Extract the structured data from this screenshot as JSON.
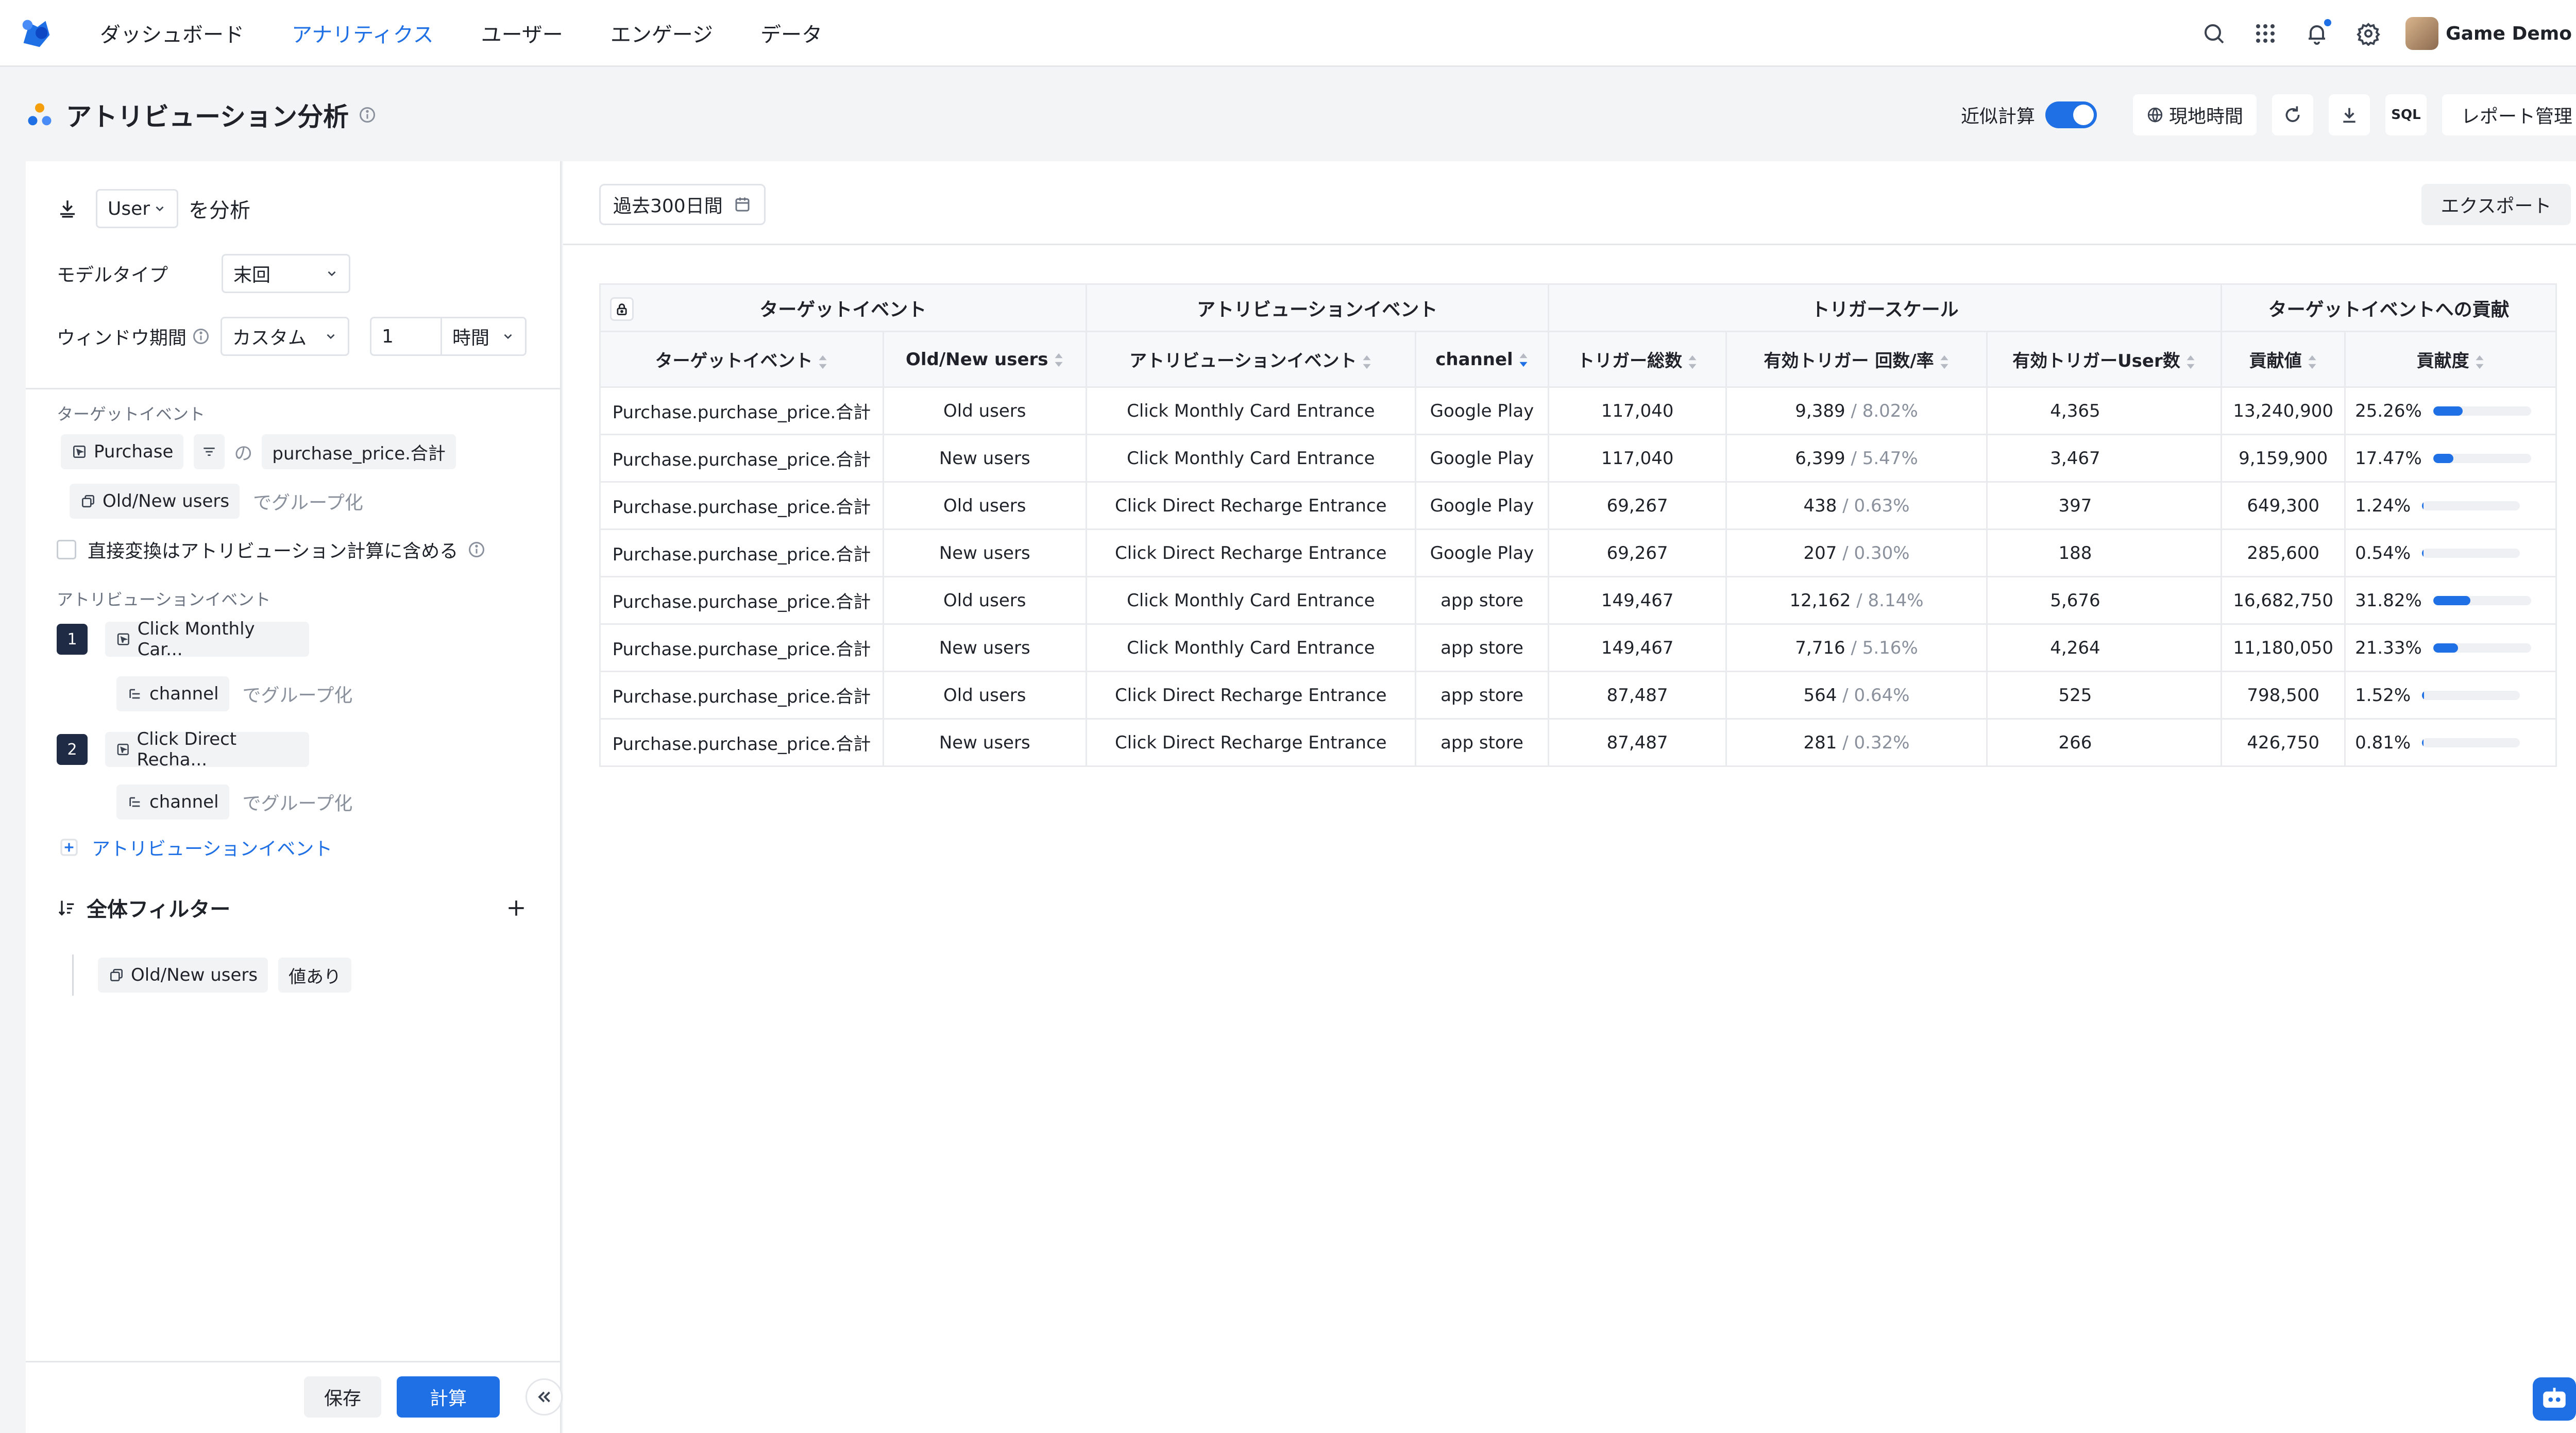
{
  "nav": {
    "items": [
      "ダッシュボード",
      "アナリティクス",
      "ユーザー",
      "エンゲージ",
      "データ"
    ],
    "active_index": 1,
    "user_name": "Game Demo",
    "accent": "#1f6fe5"
  },
  "header": {
    "title": "アトリビューション分析",
    "approx_label": "近似計算",
    "approx_on": true,
    "timezone_label": "現地時間",
    "sql_label": "SQL",
    "report_manage_label": "レポート管理"
  },
  "left": {
    "analyze_subject": "User",
    "analyze_suffix": "を分析",
    "model_type_label": "モデルタイプ",
    "model_type_value": "末回",
    "window_label": "ウィンドウ期間",
    "window_mode": "カスタム",
    "window_value": "1",
    "window_unit": "時間",
    "target_event_section": "ターゲットイベント",
    "target_event": "Purchase",
    "target_of": "の",
    "target_metric": "purchase_price.合計",
    "group_by_prop": "Old/New users",
    "group_by_suffix": "でグループ化",
    "include_direct_label": "直接変換はアトリビューション計算に含める",
    "attribution_section": "アトリビューションイベント",
    "attribution_events": [
      {
        "index": "1",
        "name": "Click Monthly Car...",
        "group_prop": "channel",
        "group_suffix": "でグループ化"
      },
      {
        "index": "2",
        "name": "Click Direct Recha...",
        "group_prop": "channel",
        "group_suffix": "でグループ化"
      }
    ],
    "add_attribution_label": "アトリビューションイベント",
    "global_filter_label": "全体フィルター",
    "filter_prop": "Old/New users",
    "filter_op": "値あり",
    "save_label": "保存",
    "calc_label": "計算"
  },
  "main": {
    "date_range": "過去300日間",
    "export_label": "エクスポート",
    "groups": [
      "ターゲットイベント",
      "アトリビューションイベント",
      "トリガースケール",
      "ターゲットイベントへの貢献"
    ],
    "columns": [
      "ターゲットイベント",
      "Old/New users",
      "アトリビューションイベント",
      "channel",
      "トリガー総数",
      "有効トリガー 回数/率",
      "有効トリガーUser数",
      "貢献値",
      "貢献度"
    ],
    "rows": [
      {
        "target": "Purchase.purchase_price.合計",
        "user_type": "Old users",
        "attr_event": "Click Monthly Card Entrance",
        "channel": "Google Play",
        "total": "117,040",
        "valid_count": "9,389",
        "valid_rate": "8.02%",
        "valid_users": "4,365",
        "contrib_value": "13,240,900",
        "contrib_pct": "25.26%",
        "contrib_frac": 0.2526
      },
      {
        "target": "Purchase.purchase_price.合計",
        "user_type": "New users",
        "attr_event": "Click Monthly Card Entrance",
        "channel": "Google Play",
        "total": "117,040",
        "valid_count": "6,399",
        "valid_rate": "5.47%",
        "valid_users": "3,467",
        "contrib_value": "9,159,900",
        "contrib_pct": "17.47%",
        "contrib_frac": 0.1747
      },
      {
        "target": "Purchase.purchase_price.合計",
        "user_type": "Old users",
        "attr_event": "Click Direct Recharge Entrance",
        "channel": "Google Play",
        "total": "69,267",
        "valid_count": "438",
        "valid_rate": "0.63%",
        "valid_users": "397",
        "contrib_value": "649,300",
        "contrib_pct": "1.24%",
        "contrib_frac": 0.0124
      },
      {
        "target": "Purchase.purchase_price.合計",
        "user_type": "New users",
        "attr_event": "Click Direct Recharge Entrance",
        "channel": "Google Play",
        "total": "69,267",
        "valid_count": "207",
        "valid_rate": "0.30%",
        "valid_users": "188",
        "contrib_value": "285,600",
        "contrib_pct": "0.54%",
        "contrib_frac": 0.0054
      },
      {
        "target": "Purchase.purchase_price.合計",
        "user_type": "Old users",
        "attr_event": "Click Monthly Card Entrance",
        "channel": "app store",
        "total": "149,467",
        "valid_count": "12,162",
        "valid_rate": "8.14%",
        "valid_users": "5,676",
        "contrib_value": "16,682,750",
        "contrib_pct": "31.82%",
        "contrib_frac": 0.3182
      },
      {
        "target": "Purchase.purchase_price.合計",
        "user_type": "New users",
        "attr_event": "Click Monthly Card Entrance",
        "channel": "app store",
        "total": "149,467",
        "valid_count": "7,716",
        "valid_rate": "5.16%",
        "valid_users": "4,264",
        "contrib_value": "11,180,050",
        "contrib_pct": "21.33%",
        "contrib_frac": 0.2133
      },
      {
        "target": "Purchase.purchase_price.合計",
        "user_type": "Old users",
        "attr_event": "Click Direct Recharge Entrance",
        "channel": "app store",
        "total": "87,487",
        "valid_count": "564",
        "valid_rate": "0.64%",
        "valid_users": "525",
        "contrib_value": "798,500",
        "contrib_pct": "1.52%",
        "contrib_frac": 0.0152
      },
      {
        "target": "Purchase.purchase_price.合計",
        "user_type": "New users",
        "attr_event": "Click Direct Recharge Entrance",
        "channel": "app store",
        "total": "87,487",
        "valid_count": "281",
        "valid_rate": "0.32%",
        "valid_users": "266",
        "contrib_value": "426,750",
        "contrib_pct": "0.81%",
        "contrib_frac": 0.0081
      }
    ]
  }
}
